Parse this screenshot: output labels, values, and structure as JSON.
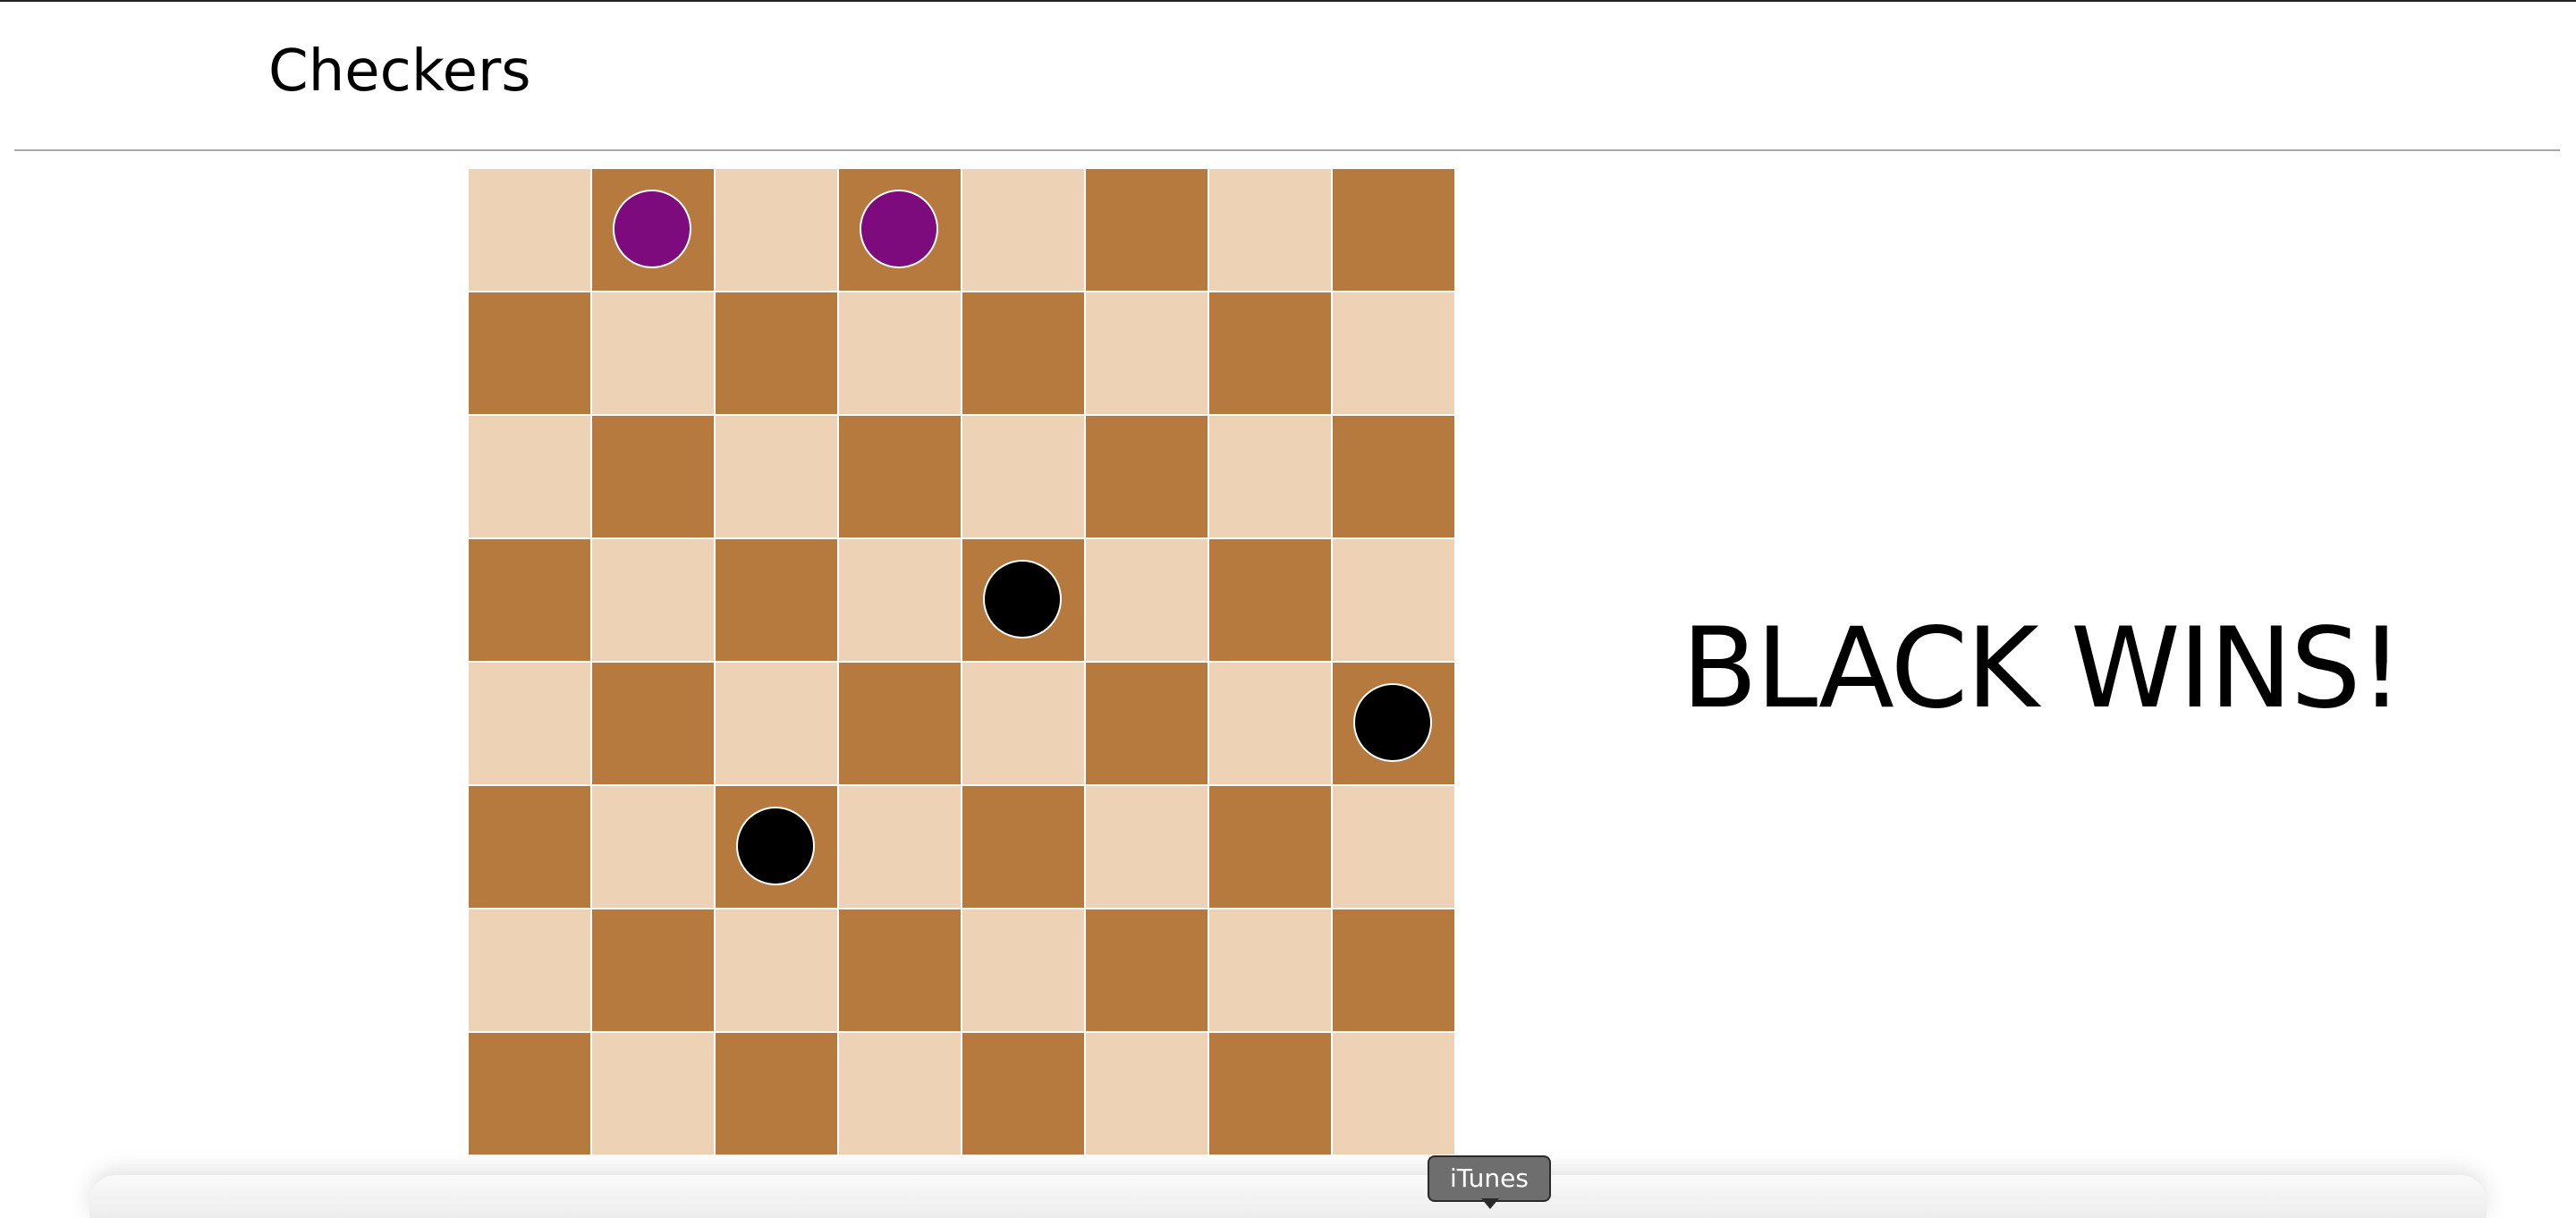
{
  "app": {
    "title": "Checkers"
  },
  "game": {
    "result_text": "BLACK WINS!",
    "board_size": 8,
    "colors": {
      "light_square": "#eed2b6",
      "dark_square": "#b67a3f",
      "purple_piece": "#7d0b7d",
      "black_piece": "#000000"
    },
    "pieces": [
      {
        "row": 0,
        "col": 1,
        "color": "purple"
      },
      {
        "row": 0,
        "col": 3,
        "color": "purple"
      },
      {
        "row": 3,
        "col": 4,
        "color": "black"
      },
      {
        "row": 4,
        "col": 7,
        "color": "black"
      },
      {
        "row": 5,
        "col": 2,
        "color": "black"
      }
    ]
  },
  "dock": {
    "tooltip": "iTunes"
  }
}
